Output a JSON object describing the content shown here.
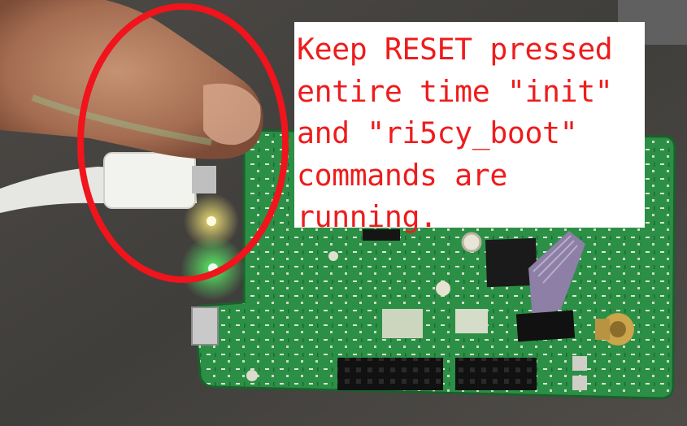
{
  "photo": {
    "subject": "finger pressing the RESET button on a green development board",
    "highlight_color": "#f0141c",
    "board_color": "#2f9a4a"
  },
  "callout": {
    "text": "Keep RESET pressed\nentire time \"init\"\nand \"ri5cy_boot\"\ncommands are\nrunning.",
    "color": "#ee1c1c"
  }
}
